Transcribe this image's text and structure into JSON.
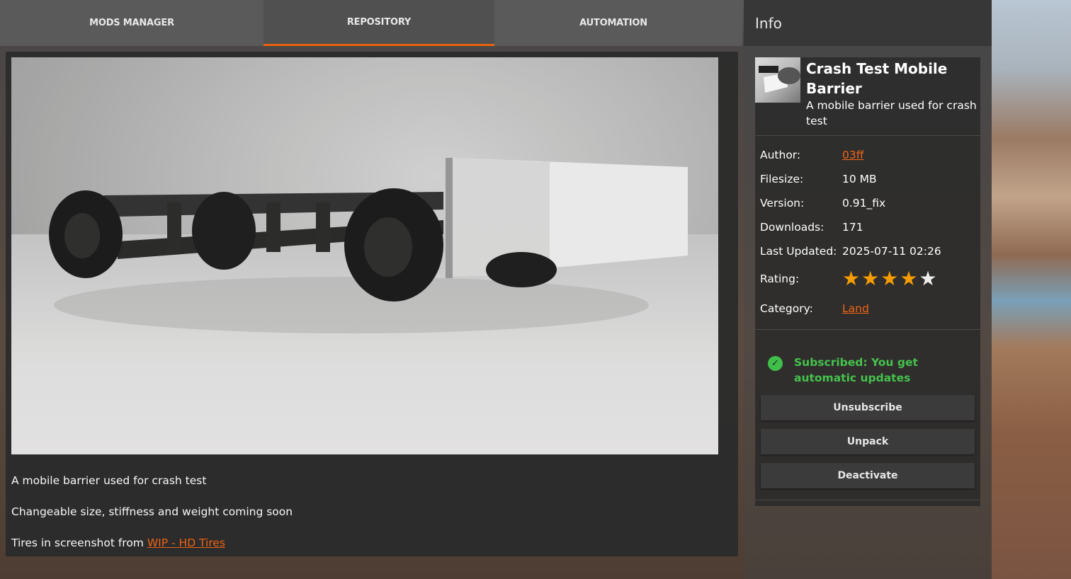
{
  "tabs": [
    {
      "label": "MODS MANAGER"
    },
    {
      "label": "REPOSITORY",
      "active": true
    },
    {
      "label": "AUTOMATION"
    }
  ],
  "description": {
    "line1": "A mobile barrier used for crash test",
    "line2": "Changeable size, stiffness and weight coming soon",
    "line3_prefix": "Tires in screenshot from ",
    "line3_link": "WIP - HD Tires"
  },
  "info": {
    "header": "Info",
    "title": "Crash Test Mobile Barrier",
    "subtitle": "A mobile barrier used for crash test",
    "fields": {
      "author_label": "Author:",
      "author": "03ff",
      "filesize_label": "Filesize:",
      "filesize": "10 MB",
      "version_label": "Version:",
      "version": "0.91_fix",
      "downloads_label": "Downloads:",
      "downloads": "171",
      "updated_label": "Last Updated:",
      "updated": "2025-07-11 02:26",
      "rating_label": "Rating:",
      "rating": 4,
      "rating_max": 5,
      "category_label": "Category:",
      "category": "Land"
    },
    "status": "Subscribed: You get automatic updates",
    "buttons": {
      "unsubscribe": "Unsubscribe",
      "unpack": "Unpack",
      "deactivate": "Deactivate"
    }
  },
  "colors": {
    "accent": "#e8620c",
    "link": "#f26414",
    "star": "#f59c00",
    "success": "#44c24c"
  }
}
